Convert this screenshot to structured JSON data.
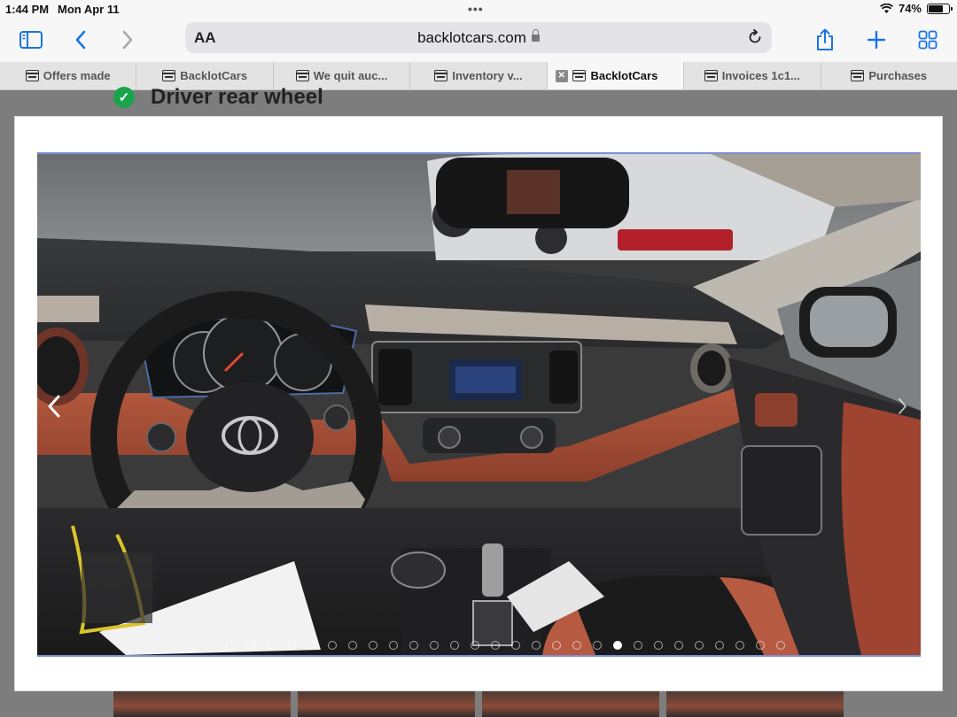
{
  "status_bar": {
    "time": "1:44 PM",
    "date": "Mon Apr 11",
    "battery_percent": "74%",
    "battery_level": 0.74
  },
  "toolbar": {
    "address_bar": {
      "text_size_button": "AA",
      "url": "backlotcars.com"
    }
  },
  "tabs": [
    {
      "label": "Offers made",
      "active": false
    },
    {
      "label": "BacklotCars",
      "active": false
    },
    {
      "label": "We quit auc...",
      "active": false
    },
    {
      "label": "Inventory v...",
      "active": false
    },
    {
      "label": "BacklotCars",
      "active": true
    },
    {
      "label": "Invoices 1c1...",
      "active": false
    },
    {
      "label": "Purchases",
      "active": false
    }
  ],
  "page": {
    "heading": "Driver rear wheel"
  },
  "gallery": {
    "dot_count": 28,
    "active_index": 19,
    "border_color": "#7a8fd6"
  },
  "colors": {
    "accent": "#1a73e8",
    "check_green": "#19a44c"
  },
  "icons": {
    "sidebar": "sidebar-icon",
    "back": "chevron-left-icon",
    "forward": "chevron-right-icon",
    "share": "share-icon",
    "new_tab": "plus-icon",
    "tabs": "grid-icon",
    "reload": "reload-icon",
    "lock": "lock-icon"
  }
}
